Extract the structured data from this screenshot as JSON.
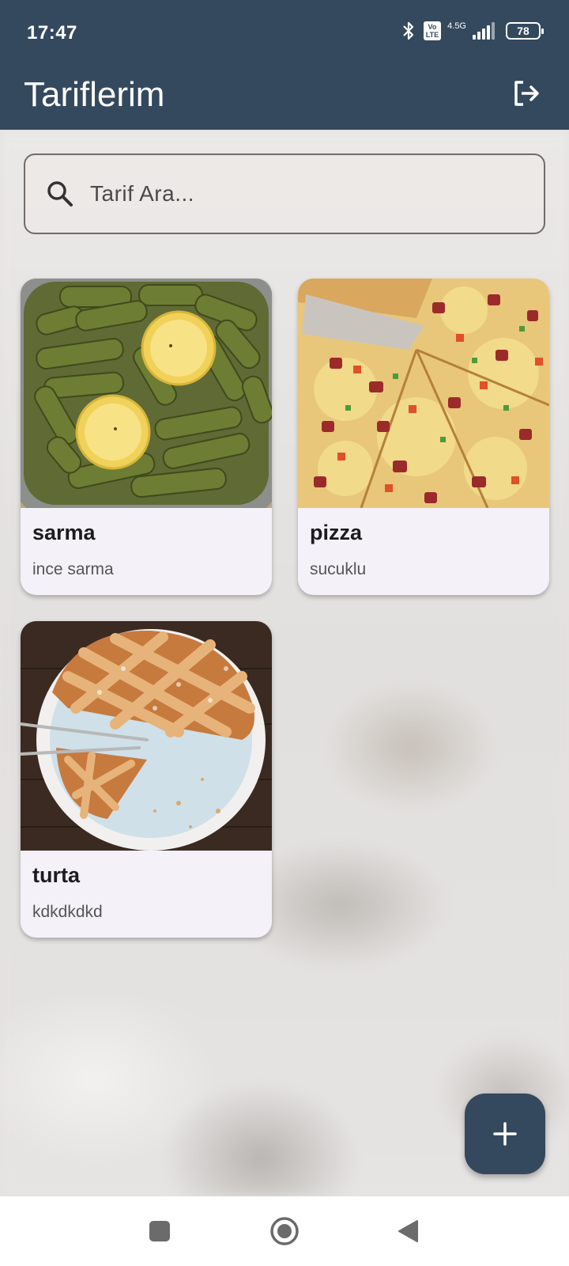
{
  "status_bar": {
    "time": "17:47",
    "volte_label": "Vo\nLTE",
    "network_label": "4.5G",
    "battery": "78"
  },
  "app_bar": {
    "title": "Tariflerim",
    "logout_icon": "logout-icon"
  },
  "search": {
    "placeholder": "Tarif Ara...",
    "value": ""
  },
  "recipes": [
    {
      "title": "sarma",
      "description": "ince sarma",
      "image": "stuffed-grape-leaves-photo"
    },
    {
      "title": "pizza",
      "description": "sucuklu",
      "image": "pizza-photo"
    },
    {
      "title": "turta",
      "description": "kdkdkdkd",
      "image": "lattice-pie-photo"
    }
  ],
  "fab": {
    "icon": "plus-icon"
  },
  "nav_bar": {
    "icons": [
      "recents-square-icon",
      "home-circle-icon",
      "back-triangle-icon"
    ]
  },
  "colors": {
    "primary": "#34495e",
    "card_bg": "#f5f1f8"
  }
}
